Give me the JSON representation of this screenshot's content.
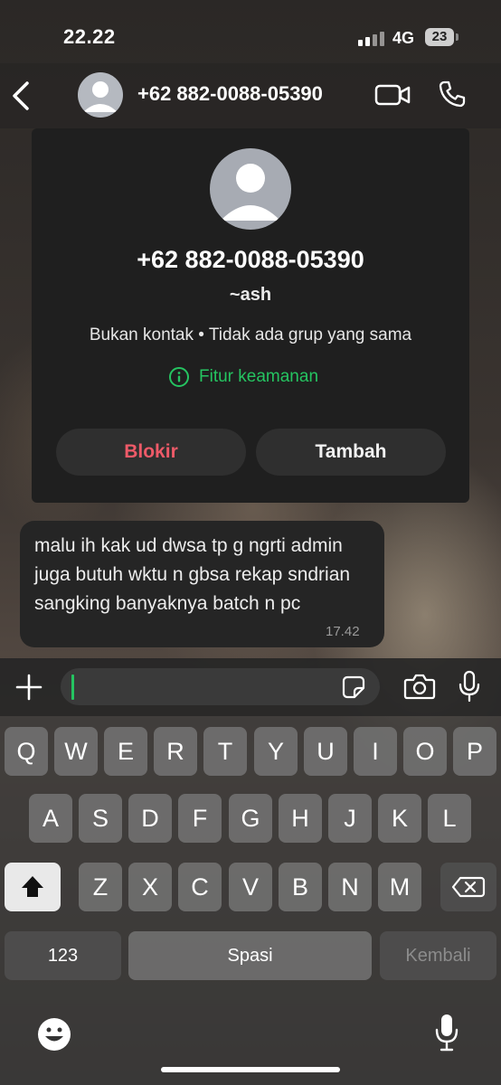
{
  "status_bar": {
    "time": "22.22",
    "network": "4G",
    "battery": "23"
  },
  "header": {
    "contact_number": "+62 882-0088-05390"
  },
  "contact_card": {
    "number": "+62 882-0088-05390",
    "alias": "~ash",
    "info": "Bukan kontak • Tidak ada grup yang sama",
    "security_link": "Fitur keamanan",
    "block_button": "Blokir",
    "add_button": "Tambah"
  },
  "messages": [
    {
      "text": "malu ih kak ud dwsa tp g ngrti admin juga butuh wktu n gbsa rekap sndrian sangking banyaknya batch n pc",
      "time": "17.42"
    }
  ],
  "keyboard": {
    "row1": [
      "Q",
      "W",
      "E",
      "R",
      "T",
      "Y",
      "U",
      "I",
      "O",
      "P"
    ],
    "row2": [
      "A",
      "S",
      "D",
      "F",
      "G",
      "H",
      "J",
      "K",
      "L"
    ],
    "row3": [
      "Z",
      "X",
      "C",
      "V",
      "B",
      "N",
      "M"
    ],
    "numbers_key": "123",
    "space_key": "Spasi",
    "return_key": "Kembali"
  },
  "colors": {
    "accent_green": "#25c461",
    "block_red": "#ee5a68"
  }
}
